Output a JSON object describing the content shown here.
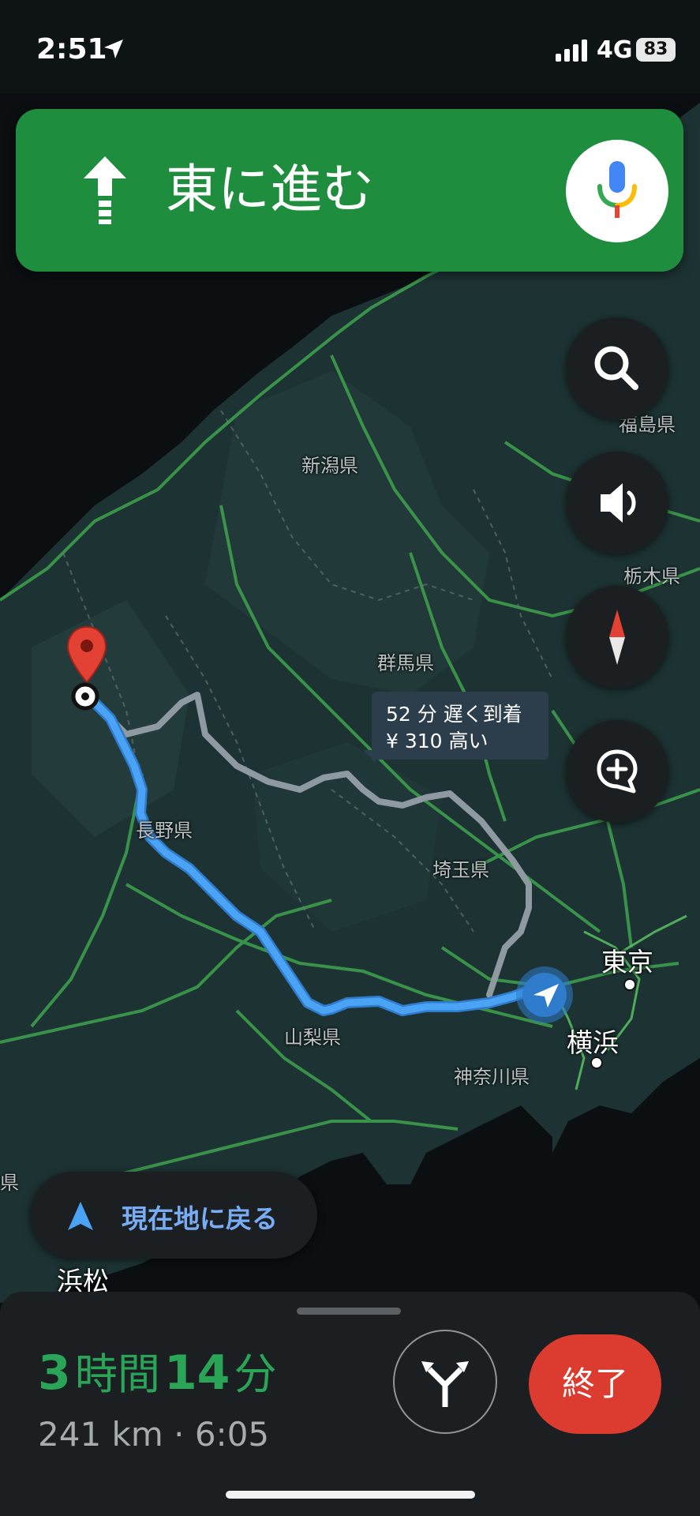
{
  "status_bar": {
    "time": "2:51",
    "network": "4G",
    "battery": "83"
  },
  "navigation": {
    "direction_text": "東に進む"
  },
  "map": {
    "region_labels": [
      "新潟県",
      "群馬県",
      "長野県",
      "埼玉県",
      "山梨県",
      "神奈川県",
      "福島県",
      "栃木県",
      "県"
    ],
    "city_labels": [
      "東京",
      "横浜",
      "浜松"
    ],
    "alt_route": {
      "line1": "52 分 遅く到着",
      "line2": "¥ 310 高い"
    }
  },
  "recenter": {
    "label": "現在地に戻る"
  },
  "trip": {
    "hours": "3",
    "hours_unit": "時間",
    "minutes": "14",
    "minutes_unit": "分",
    "distance": "241 km",
    "separator": " · ",
    "arrival": "6:05",
    "end_label": "終了"
  },
  "icons": [
    "navigation-arrow-icon",
    "straight-arrow-icon",
    "microphone-icon",
    "search-icon",
    "speaker-icon",
    "compass-icon",
    "add-report-icon",
    "location-pin-icon",
    "current-position-icon",
    "fork-routes-icon"
  ],
  "colors": {
    "banner": "#1e8e3e",
    "route": "#4aa3f4",
    "eta": "#2aa558",
    "end_button": "#dc3b2f",
    "recenter_text": "#78adf5"
  }
}
